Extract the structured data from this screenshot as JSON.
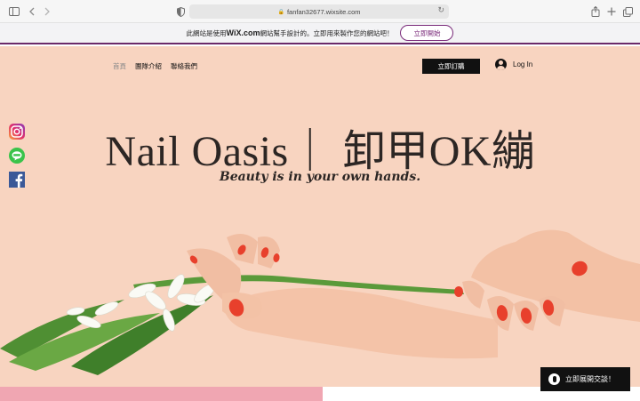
{
  "browser": {
    "url": "fanfan32677.wixsite.com",
    "icons": [
      "sidebar-icon",
      "back-icon",
      "forward-icon",
      "shield-icon",
      "lock-icon",
      "reload-icon",
      "share-icon",
      "new-tab-icon",
      "tabs-icon"
    ]
  },
  "wix_banner": {
    "text_before": "此網站是使用",
    "brand": "WiX.com",
    "text_after": "網站幫手設計的。立即用來製作您的網站吧！",
    "button_label": "立即開始"
  },
  "nav": {
    "items": [
      "首頁",
      "團隊介紹",
      "聯絡我們"
    ],
    "book_label": "立即訂購",
    "login_label": "Log In"
  },
  "social": [
    "instagram-icon",
    "line-icon",
    "facebook-icon"
  ],
  "hero": {
    "title": "Nail Oasis｜ 卸甲OK繃",
    "tagline": "Beauty is in your own hands."
  },
  "chat": {
    "label": "立即展開交談！"
  },
  "colors": {
    "hero_bg": "#f8d4c0",
    "wix_accent": "#7a2b7a",
    "nail_red": "#e8402c",
    "text_dark": "#2c2624"
  }
}
